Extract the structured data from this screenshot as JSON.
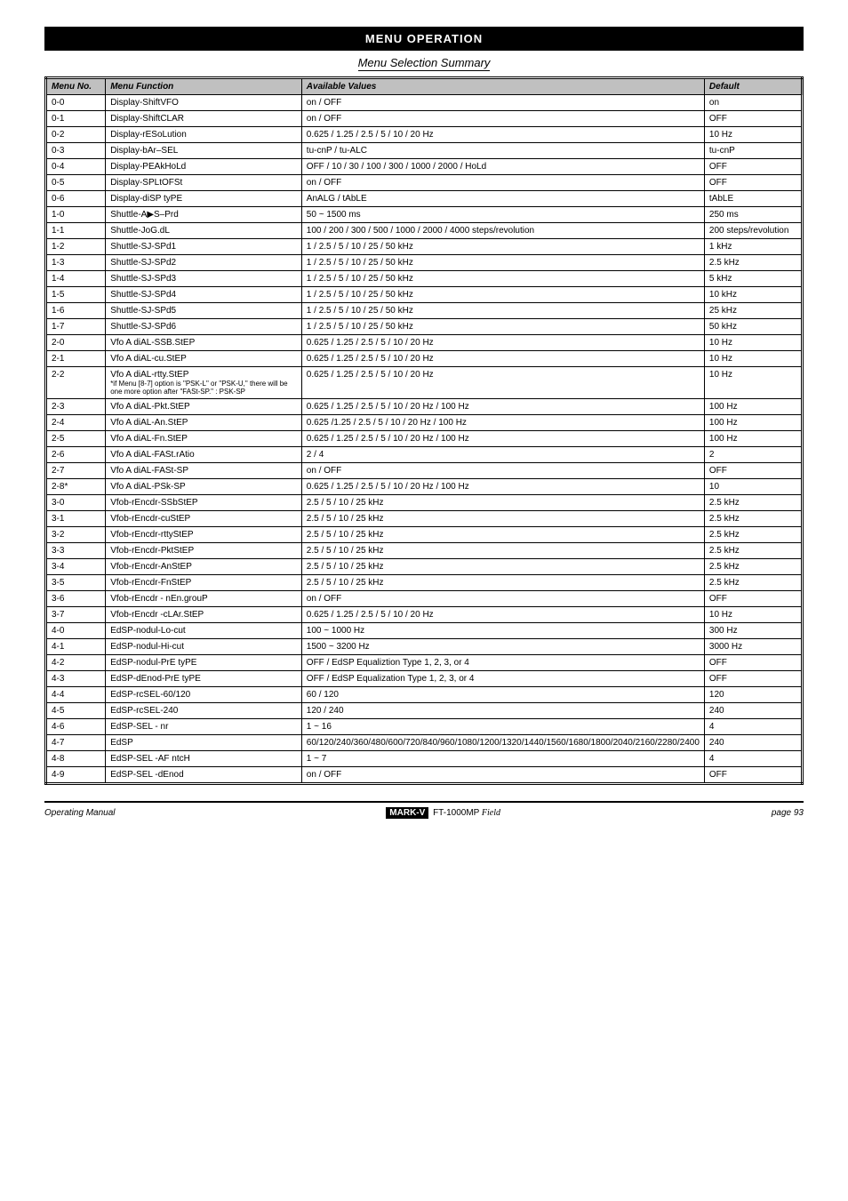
{
  "header": "MENU OPERATION",
  "subtitle": "Menu Selection Summary",
  "columns": {
    "no": "Menu No.",
    "fn": "Menu Function",
    "avail": "Available Values",
    "def": "Default"
  },
  "rows": [
    {
      "no": "0-0",
      "fn": "Display-ShiftVFO",
      "avail": "on / OFF",
      "def": "on"
    },
    {
      "no": "0-1",
      "fn": "Display-ShiftCLAR",
      "avail": "on / OFF",
      "def": "OFF"
    },
    {
      "no": "0-2",
      "fn": "Display-rESoLution",
      "avail": "0.625 / 1.25 / 2.5 / 5 / 10 / 20 Hz",
      "def": "10 Hz"
    },
    {
      "no": "0-3",
      "fn": "Display-bAr–SEL",
      "avail": "tu-cnP / tu-ALC",
      "def": "tu-cnP"
    },
    {
      "no": "0-4",
      "fn": "Display-PEAkHoLd",
      "avail": "OFF / 10 / 30 / 100 / 300 / 1000 / 2000 / HoLd",
      "def": "OFF"
    },
    {
      "no": "0-5",
      "fn": "Display-SPLtOFSt",
      "avail": "on / OFF",
      "def": "OFF"
    },
    {
      "no": "0-6",
      "fn": "Display-diSP tyPE",
      "avail": "AnALG / tAbLE",
      "def": "tAbLE"
    },
    {
      "no": "1-0",
      "fn": "Shuttle-A▶S–Prd",
      "avail": "50 ~ 1500 ms",
      "def": "250 ms"
    },
    {
      "no": "1-1",
      "fn": "Shuttle-JoG.dL",
      "avail": "100 / 200 / 300 / 500 / 1000 / 2000 / 4000 steps/revolution",
      "def": "200 steps/revolution"
    },
    {
      "no": "1-2",
      "fn": "Shuttle-SJ-SPd1",
      "avail": "1 / 2.5 / 5 / 10 / 25 / 50 kHz",
      "def": "1 kHz"
    },
    {
      "no": "1-3",
      "fn": "Shuttle-SJ-SPd2",
      "avail": "1 / 2.5 / 5 / 10 / 25 / 50 kHz",
      "def": "2.5 kHz"
    },
    {
      "no": "1-4",
      "fn": "Shuttle-SJ-SPd3",
      "avail": "1 / 2.5 / 5 / 10 / 25 / 50 kHz",
      "def": "5 kHz"
    },
    {
      "no": "1-5",
      "fn": "Shuttle-SJ-SPd4",
      "avail": "1 / 2.5 / 5 / 10 / 25 / 50 kHz",
      "def": "10 kHz"
    },
    {
      "no": "1-6",
      "fn": "Shuttle-SJ-SPd5",
      "avail": "1 / 2.5 / 5 / 10 / 25 / 50 kHz",
      "def": "25 kHz"
    },
    {
      "no": "1-7",
      "fn": "Shuttle-SJ-SPd6",
      "avail": "1 / 2.5 / 5 / 10 / 25 / 50 kHz",
      "def": "50 kHz"
    },
    {
      "no": "2-0",
      "fn": "Vfo A diAL-SSB.StEP",
      "avail": "0.625 / 1.25 / 2.5 / 5 / 10 / 20 Hz",
      "def": "10 Hz"
    },
    {
      "no": "2-1",
      "fn": "Vfo A diAL-cu.StEP",
      "avail": "0.625 / 1.25 / 2.5 / 5 / 10 / 20 Hz",
      "def": "10 Hz"
    },
    {
      "no": "2-2",
      "fn": "Vfo A diAL-rtty.StEP",
      "avail": "0.625 / 1.25 / 2.5 / 5 / 10 / 20 Hz",
      "def": "10 Hz",
      "note": "*if Menu [8-7] option is \"PSK-L\" or \"PSK-U,\" there will be one more option after \"FASt-SP.\" : PSK-SP"
    },
    {
      "no": "2-3",
      "fn": "Vfo A diAL-Pkt.StEP",
      "avail": "0.625 / 1.25 / 2.5 / 5 / 10 / 20 Hz / 100 Hz",
      "def": "100 Hz"
    },
    {
      "no": "2-4",
      "fn": "Vfo A diAL-An.StEP",
      "avail": "0.625 /1.25 / 2.5 / 5 / 10 / 20 Hz / 100 Hz",
      "def": "100 Hz"
    },
    {
      "no": "2-5",
      "fn": "Vfo A diAL-Fn.StEP",
      "avail": "0.625 / 1.25 / 2.5 / 5 / 10 / 20 Hz / 100 Hz",
      "def": "100 Hz"
    },
    {
      "no": "2-6",
      "fn": "Vfo A diAL-FASt.rAtio",
      "avail": "2 / 4",
      "def": "2"
    },
    {
      "no": "2-7",
      "fn": "Vfo A diAL-FASt-SP",
      "avail": "on / OFF",
      "def": "OFF"
    },
    {
      "no": "2-8*",
      "fn": "Vfo A diAL-PSk-SP",
      "avail": "0.625 / 1.25 / 2.5 / 5 / 10 / 20 Hz / 100 Hz",
      "def": "10"
    },
    {
      "no": "3-0",
      "fn": "Vfob-rEncdr-SSbStEP",
      "avail": "2.5 / 5 / 10 / 25 kHz",
      "def": "2.5 kHz"
    },
    {
      "no": "3-1",
      "fn": "Vfob-rEncdr-cuStEP",
      "avail": "2.5 / 5 / 10 / 25 kHz",
      "def": "2.5 kHz"
    },
    {
      "no": "3-2",
      "fn": "Vfob-rEncdr-rttyStEP",
      "avail": "2.5 / 5 / 10 / 25 kHz",
      "def": "2.5 kHz"
    },
    {
      "no": "3-3",
      "fn": "Vfob-rEncdr-PktStEP",
      "avail": "2.5 / 5 / 10 / 25 kHz",
      "def": "2.5 kHz"
    },
    {
      "no": "3-4",
      "fn": "Vfob-rEncdr-AnStEP",
      "avail": "2.5 / 5 / 10 / 25 kHz",
      "def": "2.5 kHz"
    },
    {
      "no": "3-5",
      "fn": "Vfob-rEncdr-FnStEP",
      "avail": "2.5 / 5 / 10 / 25 kHz",
      "def": "2.5 kHz"
    },
    {
      "no": "3-6",
      "fn": "Vfob-rEncdr - nEn.grouP",
      "avail": "on / OFF",
      "def": "OFF"
    },
    {
      "no": "3-7",
      "fn": "Vfob-rEncdr -cLAr.StEP",
      "avail": "0.625 / 1.25 / 2.5 / 5 / 10 / 20 Hz",
      "def": "10 Hz"
    },
    {
      "no": "4-0",
      "fn": "EdSP-nodul-Lo-cut",
      "avail": "100 ~ 1000 Hz",
      "def": "300 Hz"
    },
    {
      "no": "4-1",
      "fn": "EdSP-nodul-Hi-cut",
      "avail": "1500 ~ 3200 Hz",
      "def": "3000 Hz"
    },
    {
      "no": "4-2",
      "fn": "EdSP-nodul-PrE tyPE",
      "avail": "OFF / EdSP Equaliztion Type 1, 2, 3, or 4",
      "def": "OFF"
    },
    {
      "no": "4-3",
      "fn": "EdSP-dEnod-PrE tyPE",
      "avail": "OFF / EdSP Equalization Type 1, 2, 3, or 4",
      "def": "OFF"
    },
    {
      "no": "4-4",
      "fn": "EdSP-rcSEL-60/120",
      "avail": "60 / 120",
      "def": "120"
    },
    {
      "no": "4-5",
      "fn": "EdSP-rcSEL-240",
      "avail": "120 / 240",
      "def": "240"
    },
    {
      "no": "4-6",
      "fn": "EdSP-SEL - nr",
      "avail": "1 ~ 16",
      "def": "4"
    },
    {
      "no": "4-7",
      "fn": "EdSP",
      "avail": "60/120/240/360/480/600/720/840/960/1080/1200/1320/1440/1560/1680/1800/2040/2160/2280/2400",
      "def": "240"
    },
    {
      "no": "4-8",
      "fn": "EdSP-SEL -AF ntcH",
      "avail": "1 ~ 7",
      "def": "4"
    },
    {
      "no": "4-9",
      "fn": "EdSP-SEL -dEnod",
      "avail": "on / OFF",
      "def": "OFF"
    }
  ],
  "footer": {
    "left": "Operating Manual",
    "brand": "MARK-V",
    "model": "FT-1000MP",
    "script": "Field",
    "page": "page 93"
  }
}
